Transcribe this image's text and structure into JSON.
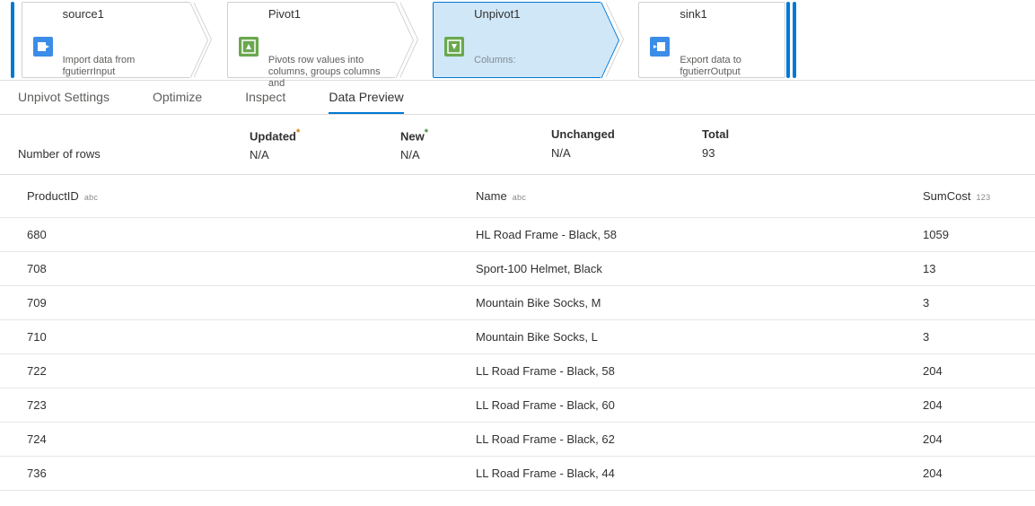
{
  "flow": {
    "nodes": [
      {
        "id": "source1",
        "title": "source1",
        "desc": "Import data from fgutierrInput",
        "icon": "source"
      },
      {
        "id": "pivot1",
        "title": "Pivot1",
        "desc": "Pivots row values into columns, groups columns and",
        "icon": "pivot"
      },
      {
        "id": "unpivot1",
        "title": "Unpivot1",
        "desc": "Columns:",
        "icon": "unpivot",
        "selected": true
      },
      {
        "id": "sink1",
        "title": "sink1",
        "desc": "Export data to fgutierrOutput",
        "icon": "sink"
      }
    ]
  },
  "tabs": [
    {
      "label": "Unpivot Settings",
      "active": false
    },
    {
      "label": "Optimize",
      "active": false
    },
    {
      "label": "Inspect",
      "active": false
    },
    {
      "label": "Data Preview",
      "active": true
    }
  ],
  "summary": {
    "row_label": "Number of rows",
    "cols": [
      {
        "header": "Updated",
        "marker": "orange",
        "value": "N/A"
      },
      {
        "header": "New",
        "marker": "green",
        "value": "N/A"
      },
      {
        "header": "Unchanged",
        "marker": "",
        "value": "N/A"
      },
      {
        "header": "Total",
        "marker": "",
        "value": "93"
      }
    ]
  },
  "table": {
    "columns": [
      {
        "name": "ProductID",
        "type": "abc"
      },
      {
        "name": "Name",
        "type": "abc"
      },
      {
        "name": "SumCost",
        "type": "123"
      }
    ],
    "rows": [
      {
        "ProductID": "680",
        "Name": "HL Road Frame - Black, 58",
        "SumCost": "1059"
      },
      {
        "ProductID": "708",
        "Name": "Sport-100 Helmet, Black",
        "SumCost": "13"
      },
      {
        "ProductID": "709",
        "Name": "Mountain Bike Socks, M",
        "SumCost": "3"
      },
      {
        "ProductID": "710",
        "Name": "Mountain Bike Socks, L",
        "SumCost": "3"
      },
      {
        "ProductID": "722",
        "Name": "LL Road Frame - Black, 58",
        "SumCost": "204"
      },
      {
        "ProductID": "723",
        "Name": "LL Road Frame - Black, 60",
        "SumCost": "204"
      },
      {
        "ProductID": "724",
        "Name": "LL Road Frame - Black, 62",
        "SumCost": "204"
      },
      {
        "ProductID": "736",
        "Name": "LL Road Frame - Black, 44",
        "SumCost": "204"
      }
    ]
  }
}
